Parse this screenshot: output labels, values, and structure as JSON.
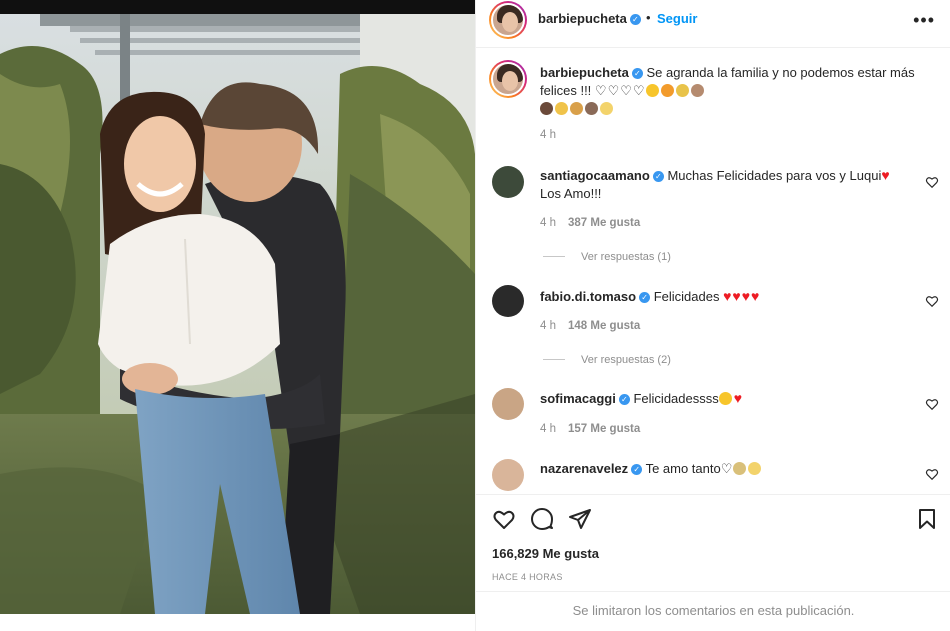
{
  "header": {
    "username": "barbiepucheta",
    "separator": "•",
    "follow_label": "Seguir",
    "more_label": "•••"
  },
  "caption": {
    "username": "barbiepucheta",
    "text": "Se agranda la familia y no podemos estar más felices !!!",
    "time": "4 h"
  },
  "comments": [
    {
      "username": "santiagocaamano",
      "text": "Muchas Felicidades para vos y Luqui",
      "text2": "Los Amo!!!",
      "time": "4 h",
      "likes": "387 Me gusta",
      "replies": "Ver respuestas (1)"
    },
    {
      "username": "fabio.di.tomaso",
      "text": "Felicidades",
      "time": "4 h",
      "likes": "148 Me gusta",
      "replies": "Ver respuestas (2)"
    },
    {
      "username": "sofimacaggi",
      "text": "Felicidadessss",
      "time": "4 h",
      "likes": "157 Me gusta"
    },
    {
      "username": "nazarenavelez",
      "text": "Te amo tanto"
    }
  ],
  "post": {
    "likes": "166,829 Me gusta",
    "time_ago": "HACE 4 HORAS",
    "comments_limited": "Se limitaron los comentarios en esta publicación."
  },
  "icons": [
    "heart-icon",
    "comment-icon",
    "share-icon",
    "bookmark-icon",
    "verified-icon",
    "more-icon"
  ],
  "colors": {
    "link_blue": "#0095f6",
    "verified_blue": "#3897f0",
    "muted": "#8e8e8e",
    "heart_red": "#ed1c24"
  }
}
